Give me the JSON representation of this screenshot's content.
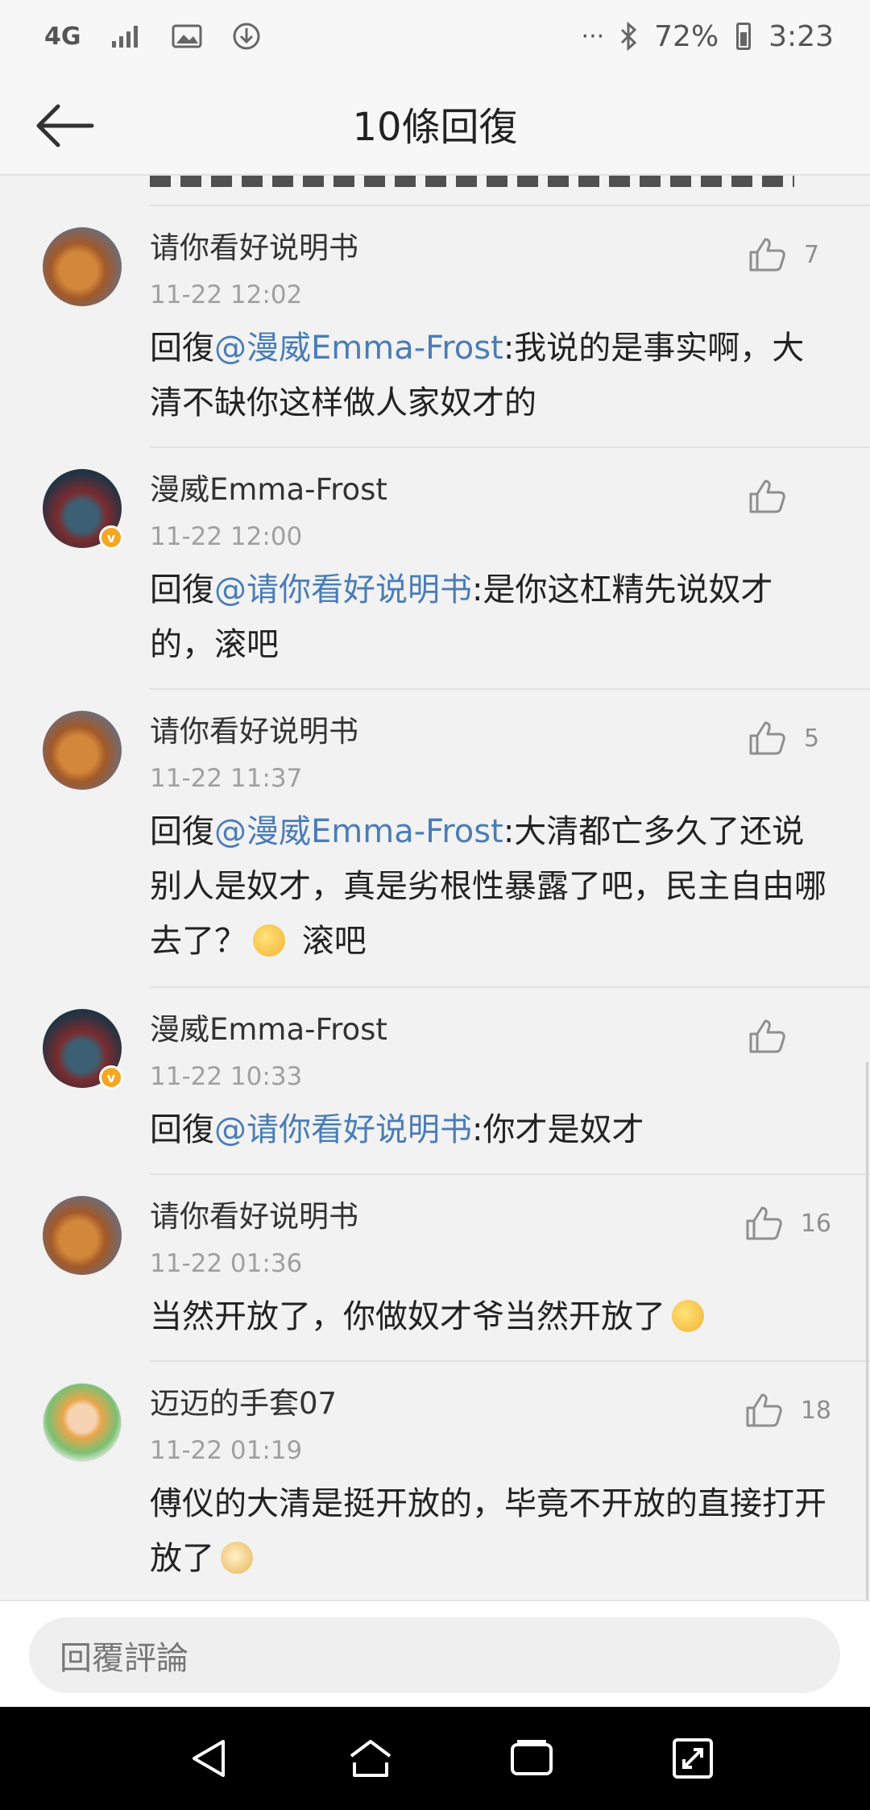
{
  "status_bar": {
    "network": "4G",
    "battery": "72%",
    "time": "3:23",
    "icons": [
      "signal-icon",
      "image-icon",
      "download-icon",
      "more-dots-icon",
      "bluetooth-icon",
      "battery-icon"
    ]
  },
  "header": {
    "title": "10條回復",
    "back_icon": "back-arrow-icon"
  },
  "comments": [
    {
      "user": "请你看好说明书",
      "time": "11-22 12:02",
      "likes": "7",
      "reply_prefix": "回復",
      "mention": "@漫威Emma-Frost",
      "body": ":我说的是事实啊，大清不缺你这样做人家奴才的"
    },
    {
      "user": "漫威Emma-Frost",
      "time": "11-22 12:00",
      "likes": "",
      "reply_prefix": "回復",
      "mention": "@请你看好说明书",
      "body": ":是你这杠精先说奴才的，滚吧"
    },
    {
      "user": "请你看好说明书",
      "time": "11-22 11:37",
      "likes": "5",
      "reply_prefix": "回復",
      "mention": "@漫威Emma-Frost",
      "body": ":大清都亡多久了还说别人是奴才，真是劣根性暴露了吧，民主自由哪去了？",
      "body_after_emoji": " 滚吧"
    },
    {
      "user": "漫威Emma-Frost",
      "time": "11-22 10:33",
      "likes": "",
      "reply_prefix": "回復",
      "mention": "@请你看好说明书",
      "body": ":你才是奴才"
    },
    {
      "user": "请你看好说明书",
      "time": "11-22 01:36",
      "likes": "16",
      "body": "当然开放了，你做奴才爷当然开放了"
    },
    {
      "user": "迈迈的手套07",
      "time": "11-22 01:19",
      "likes": "18",
      "body": "傅仪的大清是挺开放的，毕竟不开放的直接打开放了"
    }
  ],
  "reply_bar": {
    "placeholder": "回覆評論"
  },
  "nav_bar": {
    "icons": [
      "nav-back-icon",
      "nav-home-icon",
      "nav-recents-icon",
      "nav-expand-icon"
    ]
  }
}
